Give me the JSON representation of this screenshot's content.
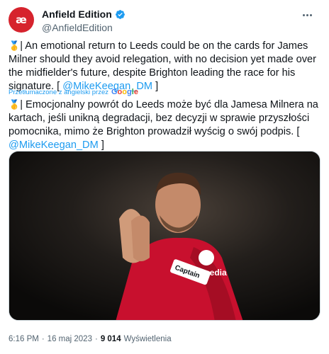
{
  "account": {
    "display_name": "Anfield Edition",
    "handle": "@AnfieldEdition",
    "avatar_text": "æ",
    "verified": true,
    "brand_color": "#d6232d"
  },
  "tweet": {
    "medal": "🥇",
    "original_text": "| An emotional return to Leeds could be on the cards for James Milner should they avoid relegation, with no decision yet made over the midfielder's future, despite Brighton leading the race for his signature. [",
    "original_mention": "@MikeKeegan_DM",
    "original_close": "]",
    "translated_label": "Przetłumaczone z angielski przez",
    "translator_brand": "Google",
    "translated_text": "| Emocjonalny powrót do Leeds może być dla Jamesa Milnera na kartach, jeśli unikną degradacji, bez decyzji w sprawie przyszłości pomocnika, mimo że Brighton prowadził wyścig o swój podpis. [",
    "translated_mention": "@MikeKeegan_DM",
    "translated_close": "]"
  },
  "media": {
    "sponsor": "expedia",
    "armband": "Captain"
  },
  "footer": {
    "time": "6:16 PM",
    "separator1": "·",
    "date": "16 maj 2023",
    "separator2": "·",
    "views_count": "9 014",
    "views_label": "Wyświetlenia"
  },
  "colors": {
    "link": "#1d9bf0",
    "text": "#0f1419",
    "muted": "#536471"
  }
}
